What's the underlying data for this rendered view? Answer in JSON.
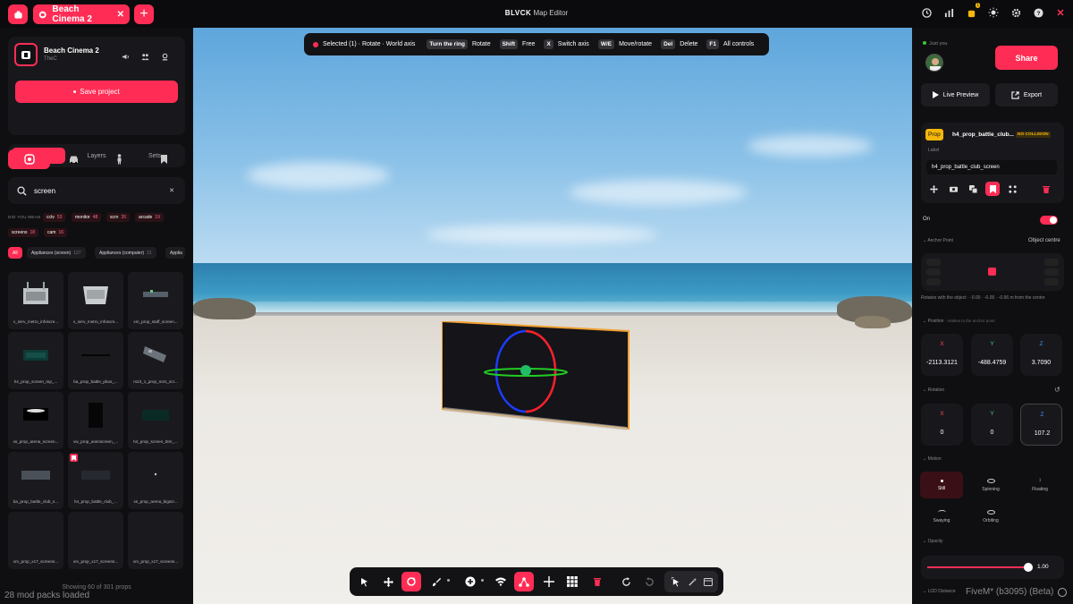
{
  "window": {
    "app_title_bold": "BLVCK",
    "app_title_rest": "Map Editor",
    "tabs": [
      {
        "label": "Beach Cinema 2"
      }
    ],
    "notification_count": "1"
  },
  "project": {
    "name": "Beach Cinema 2",
    "owner": "TheC",
    "save_label": "Save project"
  },
  "left_tabs": [
    "Objects",
    "Layers",
    "Sets"
  ],
  "search": {
    "value": "screen"
  },
  "did_you_mean": {
    "label": "DID YOU MEAN",
    "suggestions": [
      {
        "text": "cctv",
        "count": "53"
      },
      {
        "text": "monitor",
        "count": "48"
      },
      {
        "text": "scrn",
        "count": "26"
      },
      {
        "text": "arcade",
        "count": "19"
      },
      {
        "text": "screens",
        "count": "18"
      },
      {
        "text": "cam",
        "count": "16"
      }
    ]
  },
  "filters": [
    {
      "label": "All",
      "count": ""
    },
    {
      "label": "Appliances (screen)",
      "count": "127"
    },
    {
      "label": "Appliances (computer)",
      "count": "31"
    },
    {
      "label": "Applia",
      "count": ""
    }
  ],
  "objects": [
    "v_serv_metro_infoscre...",
    "v_serv_metro_infoscre...",
    "xm_prop_staff_screen...",
    "h4_prop_screen_top_...",
    "ba_prop_battle_pbus_...",
    "m23_1_prop_m31_scr...",
    "xs_prop_arena_screen...",
    "vw_prop_animscreen_...",
    "h4_prop_screen_btm_...",
    "ba_prop_battle_club_s...",
    "h4_prop_battle_club_...",
    "xs_prop_arena_bigscr...",
    "xm_prop_x17_screens...",
    "xm_prop_x17_screens...",
    "xm_prop_x17_screens..."
  ],
  "showing": "Showing 60 of 301 props",
  "mod_packs": "28 mod packs loaded",
  "selection_bar": {
    "status": "Selected (1) · Rotate · World axis",
    "hints": [
      {
        "key": "Turn the ring",
        "action": "Rotate"
      },
      {
        "key": "Shift",
        "action": "Free"
      },
      {
        "key": "X",
        "action": "Switch axis"
      },
      {
        "key": "W/E",
        "action": "Move/rotate"
      },
      {
        "key": "Del",
        "action": "Delete"
      },
      {
        "key": "F1",
        "action": "All controls"
      }
    ]
  },
  "right": {
    "just_you": "Just you",
    "share": "Share",
    "live_preview": "Live Preview",
    "export": "Export",
    "prop_badge": "Prop",
    "prop_name": "h4_prop_battle_club...",
    "no_collision": "NO COLLISION",
    "label_title": "Label",
    "label_value": "h4_prop_battle_club_screen",
    "on_label": "On",
    "anchor_title": "Anchor Point",
    "anchor_value": "Object centre",
    "anchor_note": "Rotates with the object · -0.00 · -0.00 · -0.96 m from the centre",
    "position_title": "Position",
    "position_note": "· relative to the anchor point",
    "position": {
      "x": "-2113.3121",
      "y": "-488.4759",
      "z": "3.7090"
    },
    "rotation_title": "Rotation",
    "rotation": {
      "x": "0",
      "y": "0",
      "z": "107.2"
    },
    "motion_title": "Motion",
    "motion_options": [
      "Still",
      "Spinning",
      "Floating",
      "Swaying",
      "Orbiting"
    ],
    "opacity_title": "Opacity",
    "opacity_value": "1.00",
    "lod_title": "LOD Distance"
  },
  "fivem": "FiveM* (b3095) (Beta)",
  "colors": {
    "accent": "#ff2d55",
    "prop_badge": "#f5b70a"
  }
}
